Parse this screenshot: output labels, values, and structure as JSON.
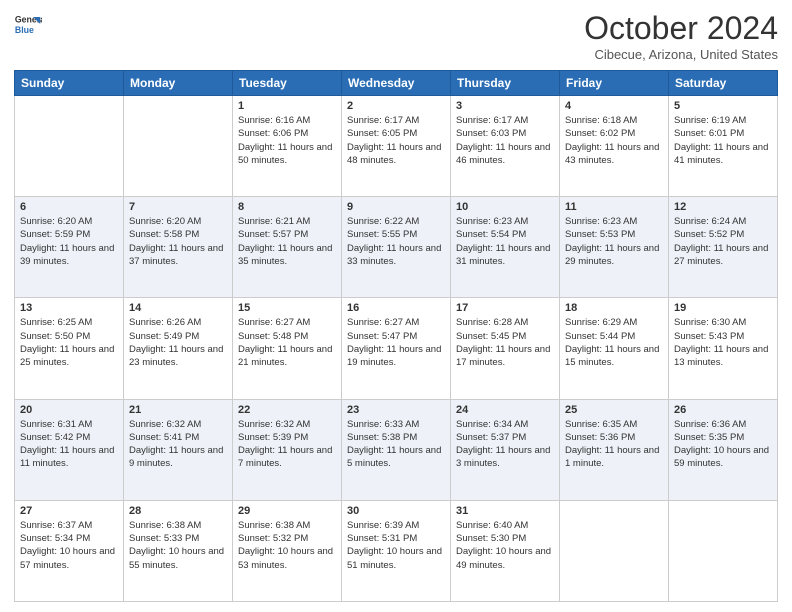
{
  "logo": {
    "general": "General",
    "blue": "Blue"
  },
  "header": {
    "month": "October 2024",
    "location": "Cibecue, Arizona, United States"
  },
  "days_of_week": [
    "Sunday",
    "Monday",
    "Tuesday",
    "Wednesday",
    "Thursday",
    "Friday",
    "Saturday"
  ],
  "weeks": [
    [
      {
        "day": "",
        "info": ""
      },
      {
        "day": "",
        "info": ""
      },
      {
        "day": "1",
        "info": "Sunrise: 6:16 AM\nSunset: 6:06 PM\nDaylight: 11 hours and 50 minutes."
      },
      {
        "day": "2",
        "info": "Sunrise: 6:17 AM\nSunset: 6:05 PM\nDaylight: 11 hours and 48 minutes."
      },
      {
        "day": "3",
        "info": "Sunrise: 6:17 AM\nSunset: 6:03 PM\nDaylight: 11 hours and 46 minutes."
      },
      {
        "day": "4",
        "info": "Sunrise: 6:18 AM\nSunset: 6:02 PM\nDaylight: 11 hours and 43 minutes."
      },
      {
        "day": "5",
        "info": "Sunrise: 6:19 AM\nSunset: 6:01 PM\nDaylight: 11 hours and 41 minutes."
      }
    ],
    [
      {
        "day": "6",
        "info": "Sunrise: 6:20 AM\nSunset: 5:59 PM\nDaylight: 11 hours and 39 minutes."
      },
      {
        "day": "7",
        "info": "Sunrise: 6:20 AM\nSunset: 5:58 PM\nDaylight: 11 hours and 37 minutes."
      },
      {
        "day": "8",
        "info": "Sunrise: 6:21 AM\nSunset: 5:57 PM\nDaylight: 11 hours and 35 minutes."
      },
      {
        "day": "9",
        "info": "Sunrise: 6:22 AM\nSunset: 5:55 PM\nDaylight: 11 hours and 33 minutes."
      },
      {
        "day": "10",
        "info": "Sunrise: 6:23 AM\nSunset: 5:54 PM\nDaylight: 11 hours and 31 minutes."
      },
      {
        "day": "11",
        "info": "Sunrise: 6:23 AM\nSunset: 5:53 PM\nDaylight: 11 hours and 29 minutes."
      },
      {
        "day": "12",
        "info": "Sunrise: 6:24 AM\nSunset: 5:52 PM\nDaylight: 11 hours and 27 minutes."
      }
    ],
    [
      {
        "day": "13",
        "info": "Sunrise: 6:25 AM\nSunset: 5:50 PM\nDaylight: 11 hours and 25 minutes."
      },
      {
        "day": "14",
        "info": "Sunrise: 6:26 AM\nSunset: 5:49 PM\nDaylight: 11 hours and 23 minutes."
      },
      {
        "day": "15",
        "info": "Sunrise: 6:27 AM\nSunset: 5:48 PM\nDaylight: 11 hours and 21 minutes."
      },
      {
        "day": "16",
        "info": "Sunrise: 6:27 AM\nSunset: 5:47 PM\nDaylight: 11 hours and 19 minutes."
      },
      {
        "day": "17",
        "info": "Sunrise: 6:28 AM\nSunset: 5:45 PM\nDaylight: 11 hours and 17 minutes."
      },
      {
        "day": "18",
        "info": "Sunrise: 6:29 AM\nSunset: 5:44 PM\nDaylight: 11 hours and 15 minutes."
      },
      {
        "day": "19",
        "info": "Sunrise: 6:30 AM\nSunset: 5:43 PM\nDaylight: 11 hours and 13 minutes."
      }
    ],
    [
      {
        "day": "20",
        "info": "Sunrise: 6:31 AM\nSunset: 5:42 PM\nDaylight: 11 hours and 11 minutes."
      },
      {
        "day": "21",
        "info": "Sunrise: 6:32 AM\nSunset: 5:41 PM\nDaylight: 11 hours and 9 minutes."
      },
      {
        "day": "22",
        "info": "Sunrise: 6:32 AM\nSunset: 5:39 PM\nDaylight: 11 hours and 7 minutes."
      },
      {
        "day": "23",
        "info": "Sunrise: 6:33 AM\nSunset: 5:38 PM\nDaylight: 11 hours and 5 minutes."
      },
      {
        "day": "24",
        "info": "Sunrise: 6:34 AM\nSunset: 5:37 PM\nDaylight: 11 hours and 3 minutes."
      },
      {
        "day": "25",
        "info": "Sunrise: 6:35 AM\nSunset: 5:36 PM\nDaylight: 11 hours and 1 minute."
      },
      {
        "day": "26",
        "info": "Sunrise: 6:36 AM\nSunset: 5:35 PM\nDaylight: 10 hours and 59 minutes."
      }
    ],
    [
      {
        "day": "27",
        "info": "Sunrise: 6:37 AM\nSunset: 5:34 PM\nDaylight: 10 hours and 57 minutes."
      },
      {
        "day": "28",
        "info": "Sunrise: 6:38 AM\nSunset: 5:33 PM\nDaylight: 10 hours and 55 minutes."
      },
      {
        "day": "29",
        "info": "Sunrise: 6:38 AM\nSunset: 5:32 PM\nDaylight: 10 hours and 53 minutes."
      },
      {
        "day": "30",
        "info": "Sunrise: 6:39 AM\nSunset: 5:31 PM\nDaylight: 10 hours and 51 minutes."
      },
      {
        "day": "31",
        "info": "Sunrise: 6:40 AM\nSunset: 5:30 PM\nDaylight: 10 hours and 49 minutes."
      },
      {
        "day": "",
        "info": ""
      },
      {
        "day": "",
        "info": ""
      }
    ]
  ]
}
